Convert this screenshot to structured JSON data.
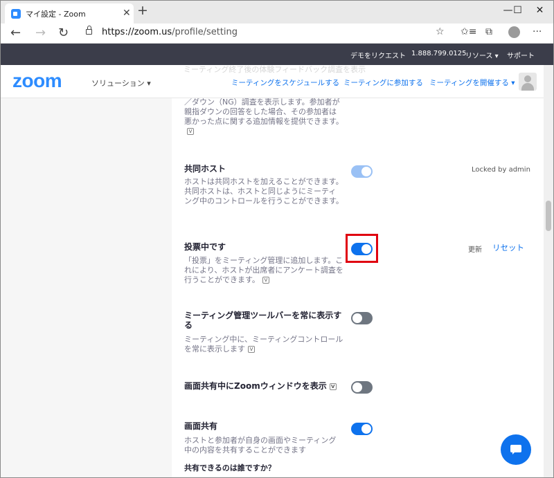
{
  "browser": {
    "tab_title": "マイ設定 - Zoom",
    "tab_close": "✕",
    "new_tab": "+",
    "controls": {
      "minimize": "—",
      "maximize": "☐",
      "close": "✕"
    },
    "back": "←",
    "forward": "→",
    "reload": "↻",
    "url_host": "https://zoom.us",
    "url_path": "/profile/setting",
    "star": "☆",
    "favorites": "✩≡",
    "collections": "⧉",
    "more": "···"
  },
  "topbar": {
    "demo": "デモをリクエスト",
    "phone": "1.888.799.0125",
    "resources": "リソース ▾",
    "support": "サポート"
  },
  "header": {
    "logo": "zoom",
    "solutions": "ソリューション ▾",
    "schedule": "ミーティングをスケジュールする",
    "join": "ミーティングに参加する",
    "host": "ミーティングを開催する ▾",
    "ghost_text": "ミーティング終了後の体験フィードバック調査を表示"
  },
  "settings": {
    "feedback_desc": "／ダウン（NG）調査を表示します。参加者が親指ダウンの回答をした場合、その参加者は悪かった点に関する追加情報を提供できます。",
    "cohost": {
      "title": "共同ホスト",
      "desc": "ホストは共同ホストを加えることができます。共同ホストは、ホストと同じようにミーティング中のコントロールを行うことができます。",
      "locked": "Locked by admin"
    },
    "polling": {
      "title": "投票中です",
      "desc": "「投票」をミーティング管理に追加します。これにより、ホストが出席者にアンケート調査を行うことができます。",
      "updated": "更新",
      "reset": "リセット"
    },
    "toolbar": {
      "title": "ミーティング管理ツールバーを常に表示する",
      "desc": "ミーティング中に、ミーティングコントロールを常に表示します"
    },
    "zoom_window": {
      "title": "画面共有中にZoomウィンドウを表示"
    },
    "screen_share": {
      "title": "画面共有",
      "desc": "ホストと参加者が自身の画面やミーティング中の内容を共有することができます",
      "who": "共有できるのは誰ですか？"
    },
    "toggle_states": {
      "cohost": "on-locked",
      "polling": "on",
      "toolbar": "off",
      "zoom_window": "off",
      "screen_share": "on"
    }
  },
  "icons": {
    "video": "V"
  },
  "colors": {
    "accent": "#0e72ed",
    "topbar": "#3b3d4a",
    "highlight": "#e0000f"
  }
}
